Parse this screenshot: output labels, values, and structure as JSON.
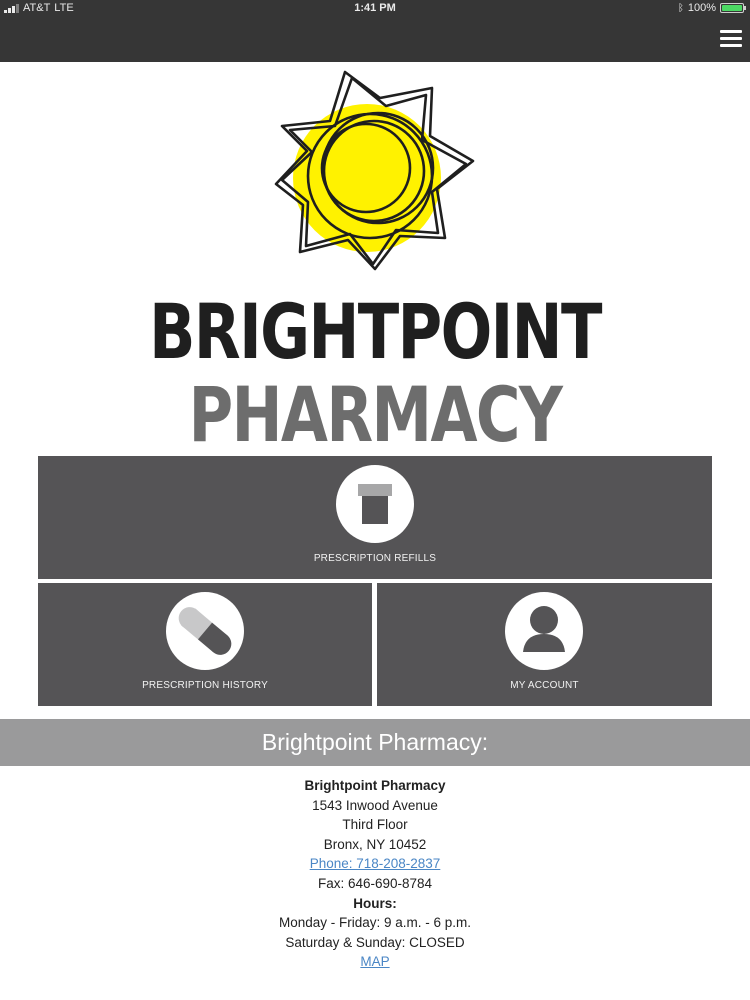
{
  "status_bar": {
    "carrier": "AT&T",
    "network": "LTE",
    "time": "1:41 PM",
    "battery_percent": "100%",
    "battery_level": 1.0,
    "battery_color": "#4cd964"
  },
  "nav": {
    "menu_icon": "hamburger-menu-icon"
  },
  "brand": {
    "line1": "BRIGHTPOINT",
    "line2": "PHARMACY",
    "sun_color": "#fff200"
  },
  "tiles": {
    "refills": {
      "label": "PRESCRIPTION REFILLS",
      "icon": "pill-bottle-icon"
    },
    "history": {
      "label": "PRESCRIPTION HISTORY",
      "icon": "capsule-icon"
    },
    "account": {
      "label": "MY ACCOUNT",
      "icon": "user-icon"
    },
    "tile_color": "#555456"
  },
  "banner": {
    "title": "Brightpoint Pharmacy:"
  },
  "contact": {
    "name": "Brightpoint Pharmacy",
    "address1": "1543 Inwood Avenue",
    "address2": "Third Floor",
    "city_state_zip": "Bronx, NY 10452",
    "phone": "Phone: 718-208-2837",
    "fax": "Fax: 646-690-8784",
    "hours_heading": "Hours:",
    "hours_weekday": "Monday - Friday: 9 a.m. - 6 p.m.",
    "hours_weekend": "Saturday & Sunday: CLOSED",
    "map_link": "MAP",
    "link_color": "#4a86c5"
  }
}
